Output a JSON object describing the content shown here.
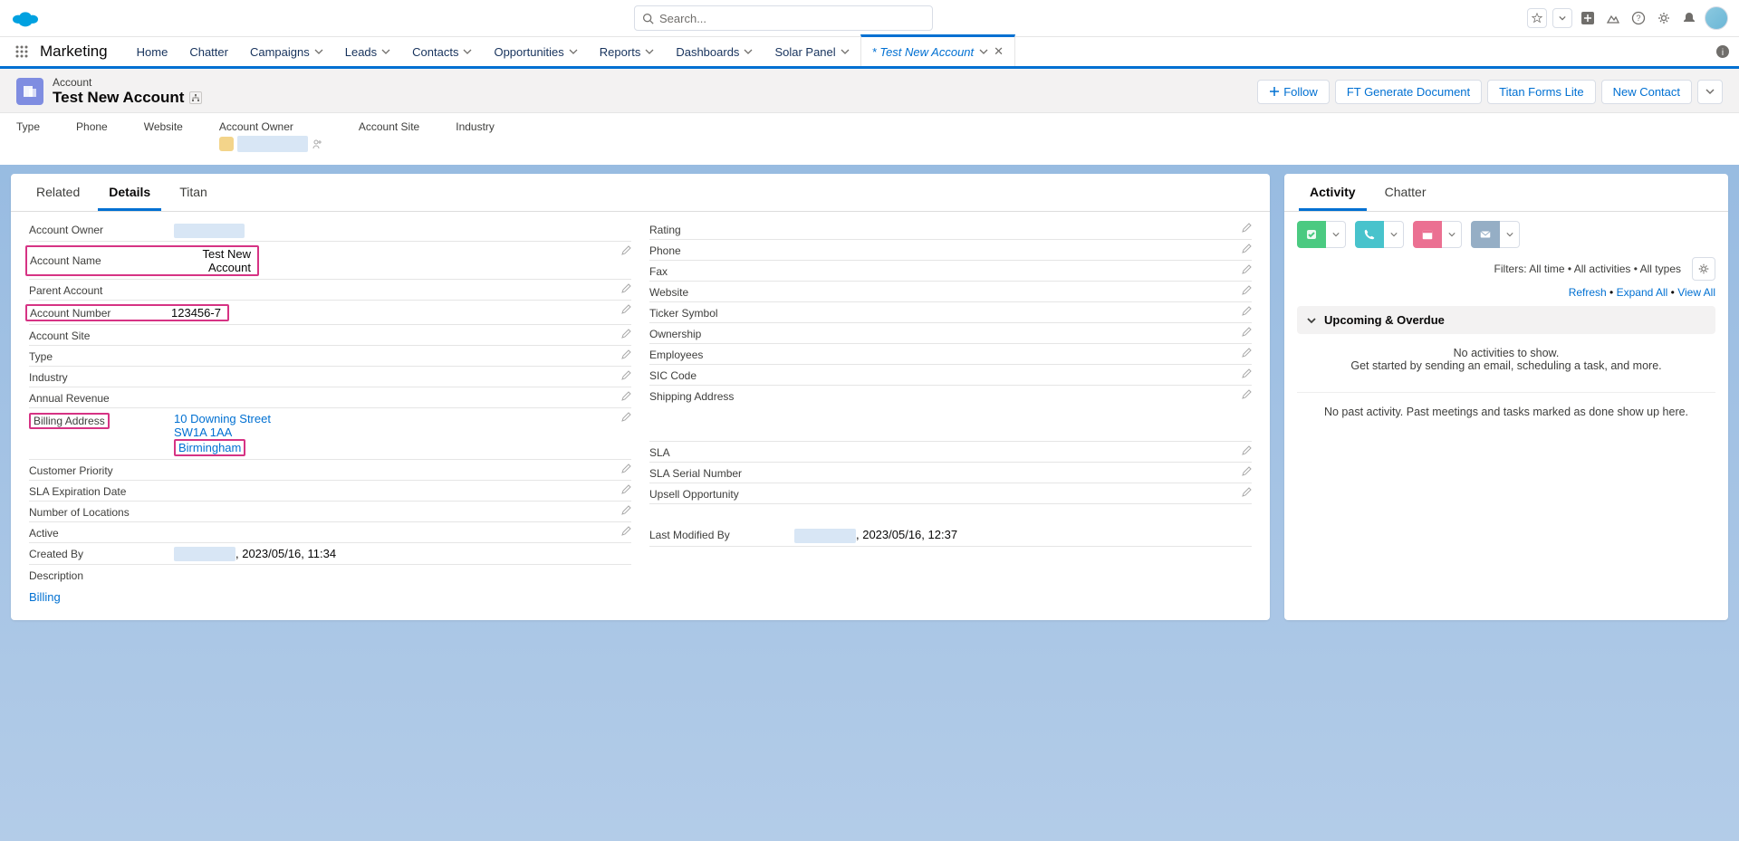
{
  "header": {
    "search_placeholder": "Search...",
    "app_name": "Marketing",
    "nav": [
      "Home",
      "Chatter",
      "Campaigns",
      "Leads",
      "Contacts",
      "Opportunities",
      "Reports",
      "Dashboards",
      "Solar Panel"
    ],
    "open_tab": "* Test New Account"
  },
  "record": {
    "object": "Account",
    "title": "Test New Account",
    "actions": {
      "follow": "Follow",
      "ft_generate": "FT Generate Document",
      "titan_forms": "Titan Forms Lite",
      "new_contact": "New Contact"
    },
    "highlights": [
      {
        "label": "Type"
      },
      {
        "label": "Phone"
      },
      {
        "label": "Website"
      },
      {
        "label": "Account Owner"
      },
      {
        "label": "Account Site"
      },
      {
        "label": "Industry"
      }
    ]
  },
  "tabs": {
    "related": "Related",
    "details": "Details",
    "titan": "Titan"
  },
  "details": {
    "left": [
      {
        "label": "Account Owner",
        "value": "",
        "masked": true
      },
      {
        "label": "Account Name",
        "value": "Test New Account",
        "editable": true,
        "highlighted": true
      },
      {
        "label": "Parent Account",
        "value": "",
        "editable": true
      },
      {
        "label": "Account Number",
        "value": "123456-7",
        "editable": true,
        "highlighted_partial": true
      },
      {
        "label": "Account Site",
        "value": "",
        "editable": true
      },
      {
        "label": "Type",
        "value": "",
        "editable": true
      },
      {
        "label": "Industry",
        "value": "",
        "editable": true
      },
      {
        "label": "Annual Revenue",
        "value": "",
        "editable": true
      }
    ],
    "billing": {
      "label": "Billing Address",
      "line1": "10 Downing Street",
      "line2": "SW1A 1AA",
      "line3": "Birmingham"
    },
    "left2": [
      {
        "label": "Customer Priority",
        "value": "",
        "editable": true
      },
      {
        "label": "SLA Expiration Date",
        "value": "",
        "editable": true
      },
      {
        "label": "Number of Locations",
        "value": "",
        "editable": true
      },
      {
        "label": "Active",
        "value": "",
        "editable": true
      }
    ],
    "created_by": {
      "label": "Created By",
      "value": ", 2023/05/16, 11:34"
    },
    "description": {
      "label": "Description",
      "value": ""
    },
    "billing_link": "Billing",
    "right": [
      {
        "label": "Rating",
        "value": "",
        "editable": true
      },
      {
        "label": "Phone",
        "value": "",
        "editable": true
      },
      {
        "label": "Fax",
        "value": "",
        "editable": true
      },
      {
        "label": "Website",
        "value": "",
        "editable": true
      },
      {
        "label": "Ticker Symbol",
        "value": "",
        "editable": true
      },
      {
        "label": "Ownership",
        "value": "",
        "editable": true
      },
      {
        "label": "Employees",
        "value": "",
        "editable": true
      },
      {
        "label": "SIC Code",
        "value": "",
        "editable": true
      },
      {
        "label": "Shipping Address",
        "value": "",
        "editable": true
      }
    ],
    "right2": [
      {
        "label": "SLA",
        "value": "",
        "editable": true
      },
      {
        "label": "SLA Serial Number",
        "value": "",
        "editable": true
      },
      {
        "label": "Upsell Opportunity",
        "value": "",
        "editable": true
      }
    ],
    "modified_by": {
      "label": "Last Modified By",
      "value": ", 2023/05/16, 12:37"
    }
  },
  "activity": {
    "tabs": {
      "activity": "Activity",
      "chatter": "Chatter"
    },
    "filters": "Filters: All time • All activities • All types",
    "links": {
      "refresh": "Refresh",
      "expand": "Expand All",
      "view_all": "View All"
    },
    "upcoming": "Upcoming & Overdue",
    "empty1": "No activities to show.",
    "empty2": "Get started by sending an email, scheduling a task, and more.",
    "past": "No past activity. Past meetings and tasks marked as done show up here."
  }
}
